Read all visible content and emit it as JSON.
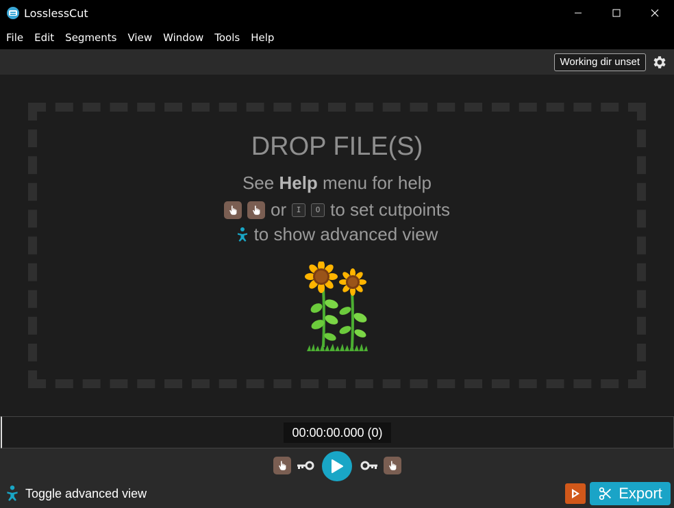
{
  "window": {
    "title": "LosslessCut"
  },
  "menu": [
    "File",
    "Edit",
    "Segments",
    "View",
    "Window",
    "Tools",
    "Help"
  ],
  "topbar": {
    "working_dir_label": "Working dir unset"
  },
  "drop": {
    "title": "DROP FILE(S)",
    "help_prefix": "See ",
    "help_bold": "Help",
    "help_suffix": " menu for help",
    "or_text": "or",
    "key_in": "I",
    "key_out": "O",
    "cutpoints_text": "to set cutpoints",
    "advanced_text": "to show advanced view"
  },
  "timeline": {
    "timecode": "00:00:00.000 (0)"
  },
  "bottom": {
    "toggle_label": "Toggle advanced view",
    "export_label": "Export"
  },
  "colors": {
    "accent": "#1aa4c7",
    "export_preview": "#d1581a",
    "hand_button": "#7a5e52"
  }
}
